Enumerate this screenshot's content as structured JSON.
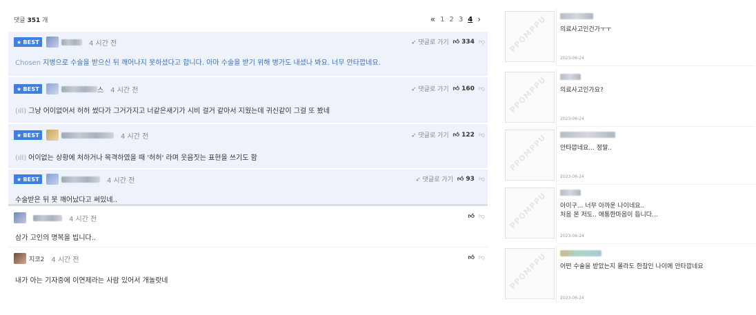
{
  "comments_header": {
    "label": "댓글",
    "count": "351",
    "unit": "개"
  },
  "pager": {
    "prev": "«",
    "pages": [
      "1",
      "2",
      "3",
      "4"
    ],
    "current": "4",
    "next": "›"
  },
  "best_badge": "BEST",
  "reply_link": "댓글로 가기",
  "comments": [
    {
      "type": "best",
      "time": "4 시간 전",
      "upvotes": "334",
      "prefix": "Chosen",
      "text": "지병으로 수술을 받으신 뒤 깨어나지 못하셨다고 합니다. 아마 수술을 받기 위해 병가도 내셨나 봐요. 너무 안타깝네요."
    },
    {
      "type": "best",
      "nick_suffix": "스",
      "time": "4 시간 전",
      "upvotes": "160",
      "prefix": "(ıll)",
      "text": "그냥 어이없어서 허허 썼다가 그거가지고 너같은새기가 시비 걸거 같아서 지웠는데 귀신같이 그걸 또 봤네"
    },
    {
      "type": "best",
      "time": "4 시간 전",
      "upvotes": "122",
      "prefix": "(ıll)",
      "text": "어이없는 상황에 처하거나 목격하였을 때 '허허' 라며 웃음짓는 표현을 쓰기도 함"
    },
    {
      "type": "best",
      "time": "4 시간 전",
      "upvotes": "93",
      "text": "수술받은 뒤 못 깨어났다고 써있네.."
    },
    {
      "type": "normal",
      "time": "4 시간 전",
      "text": "삼가 고인의 명복을 빕니다.."
    },
    {
      "type": "normal",
      "nick": "지코2",
      "time": "4 시간 전",
      "text": "내가 아는 기자중에 이연제라는 사람 있어서 개놀랏네"
    }
  ],
  "side_comments": [
    {
      "thumb_label": "PPOMPPU",
      "text_lines": [
        "의료사고인건가ㅜㅜ"
      ],
      "date": "2023-06-24"
    },
    {
      "thumb_label": "PPOMPPU",
      "text_lines": [
        "의료사고인가요?"
      ],
      "date": "2023-06-24"
    },
    {
      "thumb_label": "PPOMPPU",
      "text_lines": [
        "안타깝네요... 정말.."
      ],
      "date": "2023-06-24"
    },
    {
      "thumb_label": "PPOMPPU",
      "text_lines": [
        "아이구... 너무 아까운 나이네요..",
        "처음 본 저도.. 애통한마음이 듭니다..."
      ],
      "date": "2023-06-24"
    },
    {
      "thumb_label": "PPOMPPU",
      "text_lines": [
        "어떤 수술을 받았는지 몰라도 한참인 나이에 안타깝네요"
      ],
      "date": "2023-06-24"
    }
  ],
  "colors": {
    "accent": "#3f7fe0",
    "best_bg": "#eef3fb",
    "link_blue": "#3a6fb8"
  }
}
